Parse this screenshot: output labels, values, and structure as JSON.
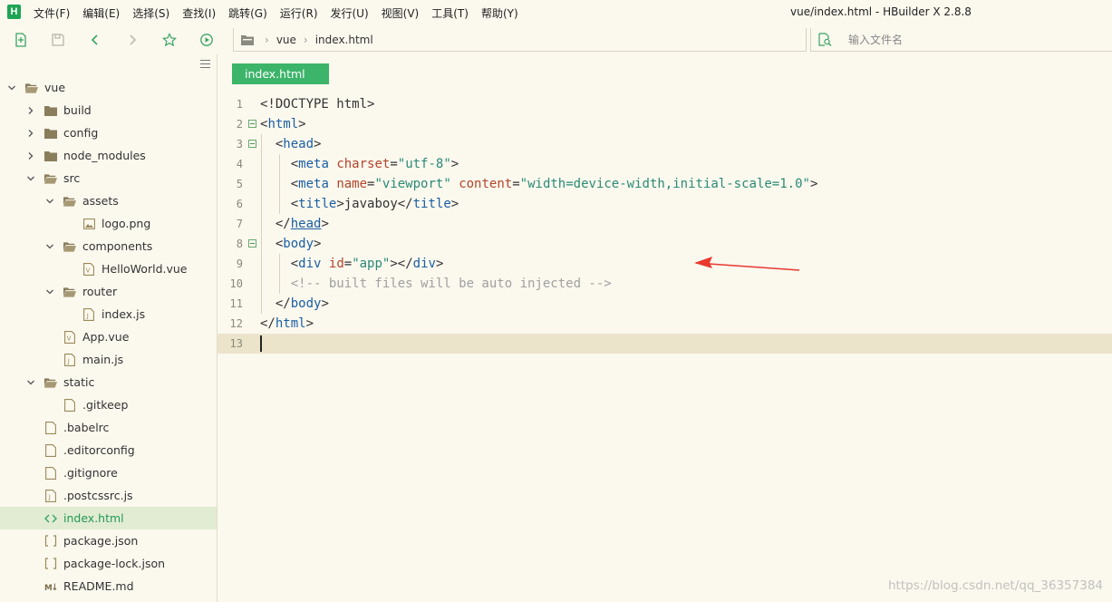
{
  "app": {
    "logo_letter": "H",
    "window_title": "vue/index.html - HBuilder X 2.8.8"
  },
  "menu": [
    {
      "label": "文件(F)"
    },
    {
      "label": "编辑(E)"
    },
    {
      "label": "选择(S)"
    },
    {
      "label": "查找(I)"
    },
    {
      "label": "跳转(G)"
    },
    {
      "label": "运行(R)"
    },
    {
      "label": "发行(U)"
    },
    {
      "label": "视图(V)"
    },
    {
      "label": "工具(T)"
    },
    {
      "label": "帮助(Y)"
    }
  ],
  "toolbar": {
    "icons": [
      "new-file-icon",
      "save-icon",
      "back-arrow-icon",
      "forward-arrow-icon",
      "star-icon",
      "run-icon"
    ],
    "breadcrumb": [
      "vue",
      "index.html"
    ],
    "search_placeholder": "输入文件名"
  },
  "tree": [
    {
      "label": "vue",
      "depth": 0,
      "type": "folder",
      "expanded": true
    },
    {
      "label": "build",
      "depth": 1,
      "type": "folder",
      "expanded": false
    },
    {
      "label": "config",
      "depth": 1,
      "type": "folder",
      "expanded": false
    },
    {
      "label": "node_modules",
      "depth": 1,
      "type": "folder",
      "expanded": false
    },
    {
      "label": "src",
      "depth": 1,
      "type": "folder",
      "expanded": true
    },
    {
      "label": "assets",
      "depth": 2,
      "type": "folder",
      "expanded": true
    },
    {
      "label": "logo.png",
      "depth": 3,
      "type": "image"
    },
    {
      "label": "components",
      "depth": 2,
      "type": "folder",
      "expanded": true
    },
    {
      "label": "HelloWorld.vue",
      "depth": 3,
      "type": "vue"
    },
    {
      "label": "router",
      "depth": 2,
      "type": "folder",
      "expanded": true
    },
    {
      "label": "index.js",
      "depth": 3,
      "type": "js"
    },
    {
      "label": "App.vue",
      "depth": 2,
      "type": "vue"
    },
    {
      "label": "main.js",
      "depth": 2,
      "type": "js"
    },
    {
      "label": "static",
      "depth": 1,
      "type": "folder",
      "expanded": true
    },
    {
      "label": ".gitkeep",
      "depth": 2,
      "type": "file"
    },
    {
      "label": ".babelrc",
      "depth": 1,
      "type": "file"
    },
    {
      "label": ".editorconfig",
      "depth": 1,
      "type": "file"
    },
    {
      "label": ".gitignore",
      "depth": 1,
      "type": "file"
    },
    {
      "label": ".postcssrc.js",
      "depth": 1,
      "type": "js"
    },
    {
      "label": "index.html",
      "depth": 1,
      "type": "html",
      "selected": true
    },
    {
      "label": "package.json",
      "depth": 1,
      "type": "json"
    },
    {
      "label": "package-lock.json",
      "depth": 1,
      "type": "json"
    },
    {
      "label": "README.md",
      "depth": 1,
      "type": "md"
    }
  ],
  "editor": {
    "tab_label": "index.html",
    "lines": [
      {
        "num": "1",
        "fold": false,
        "tokens": [
          {
            "t": "<!DOCTYPE html>",
            "c": "p"
          }
        ]
      },
      {
        "num": "2",
        "fold": true,
        "tokens": [
          {
            "t": "<",
            "c": "p"
          },
          {
            "t": "html",
            "c": "tag"
          },
          {
            "t": ">",
            "c": "p"
          }
        ]
      },
      {
        "num": "3",
        "fold": true,
        "tokens": [
          {
            "t": "  <",
            "c": "p"
          },
          {
            "t": "head",
            "c": "tag"
          },
          {
            "t": ">",
            "c": "p"
          }
        ]
      },
      {
        "num": "4",
        "fold": false,
        "tokens": [
          {
            "t": "    <",
            "c": "p"
          },
          {
            "t": "meta",
            "c": "tag"
          },
          {
            "t": " ",
            "c": "p"
          },
          {
            "t": "charset",
            "c": "attr"
          },
          {
            "t": "=",
            "c": "p"
          },
          {
            "t": "\"utf-8\"",
            "c": "str"
          },
          {
            "t": ">",
            "c": "p"
          }
        ]
      },
      {
        "num": "5",
        "fold": false,
        "tokens": [
          {
            "t": "    <",
            "c": "p"
          },
          {
            "t": "meta",
            "c": "tag"
          },
          {
            "t": " ",
            "c": "p"
          },
          {
            "t": "name",
            "c": "attr"
          },
          {
            "t": "=",
            "c": "p"
          },
          {
            "t": "\"viewport\"",
            "c": "str"
          },
          {
            "t": " ",
            "c": "p"
          },
          {
            "t": "content",
            "c": "attr"
          },
          {
            "t": "=",
            "c": "p"
          },
          {
            "t": "\"width=device-width,initial-scale=1.0\"",
            "c": "str"
          },
          {
            "t": ">",
            "c": "p"
          }
        ]
      },
      {
        "num": "6",
        "fold": false,
        "tokens": [
          {
            "t": "    <",
            "c": "p"
          },
          {
            "t": "title",
            "c": "tag"
          },
          {
            "t": ">javaboy</",
            "c": "p"
          },
          {
            "t": "title",
            "c": "tag"
          },
          {
            "t": ">",
            "c": "p"
          }
        ]
      },
      {
        "num": "7",
        "fold": false,
        "tokens": [
          {
            "t": "  </",
            "c": "p"
          },
          {
            "t": "head",
            "c": "tag u"
          },
          {
            "t": ">",
            "c": "p"
          }
        ]
      },
      {
        "num": "8",
        "fold": true,
        "tokens": [
          {
            "t": "  <",
            "c": "p"
          },
          {
            "t": "body",
            "c": "tag"
          },
          {
            "t": ">",
            "c": "p"
          }
        ]
      },
      {
        "num": "9",
        "fold": false,
        "tokens": [
          {
            "t": "    <",
            "c": "p"
          },
          {
            "t": "div",
            "c": "tag"
          },
          {
            "t": " ",
            "c": "p"
          },
          {
            "t": "id",
            "c": "attr"
          },
          {
            "t": "=",
            "c": "p"
          },
          {
            "t": "\"app\"",
            "c": "str"
          },
          {
            "t": "></",
            "c": "p"
          },
          {
            "t": "div",
            "c": "tag"
          },
          {
            "t": ">",
            "c": "p"
          }
        ]
      },
      {
        "num": "10",
        "fold": false,
        "tokens": [
          {
            "t": "    <!-- built files will be auto injected -->",
            "c": "cm"
          }
        ]
      },
      {
        "num": "11",
        "fold": false,
        "tokens": [
          {
            "t": "  </",
            "c": "p"
          },
          {
            "t": "body",
            "c": "tag"
          },
          {
            "t": ">",
            "c": "p"
          }
        ]
      },
      {
        "num": "12",
        "fold": false,
        "tokens": [
          {
            "t": "</",
            "c": "p"
          },
          {
            "t": "html",
            "c": "tag"
          },
          {
            "t": ">",
            "c": "p"
          }
        ]
      },
      {
        "num": "13",
        "fold": false,
        "current": true,
        "tokens": []
      }
    ]
  },
  "watermark": "https://blog.csdn.net/qq_36357384",
  "colors": {
    "accent": "#3cb46a",
    "background": "#fbf8ee",
    "selected_row": "#e2ecd3",
    "tag": "#1a5fa3",
    "attr": "#b4442a",
    "string": "#2a8a76",
    "comment": "#a0a0a0",
    "annotation_arrow": "#e8392f"
  }
}
